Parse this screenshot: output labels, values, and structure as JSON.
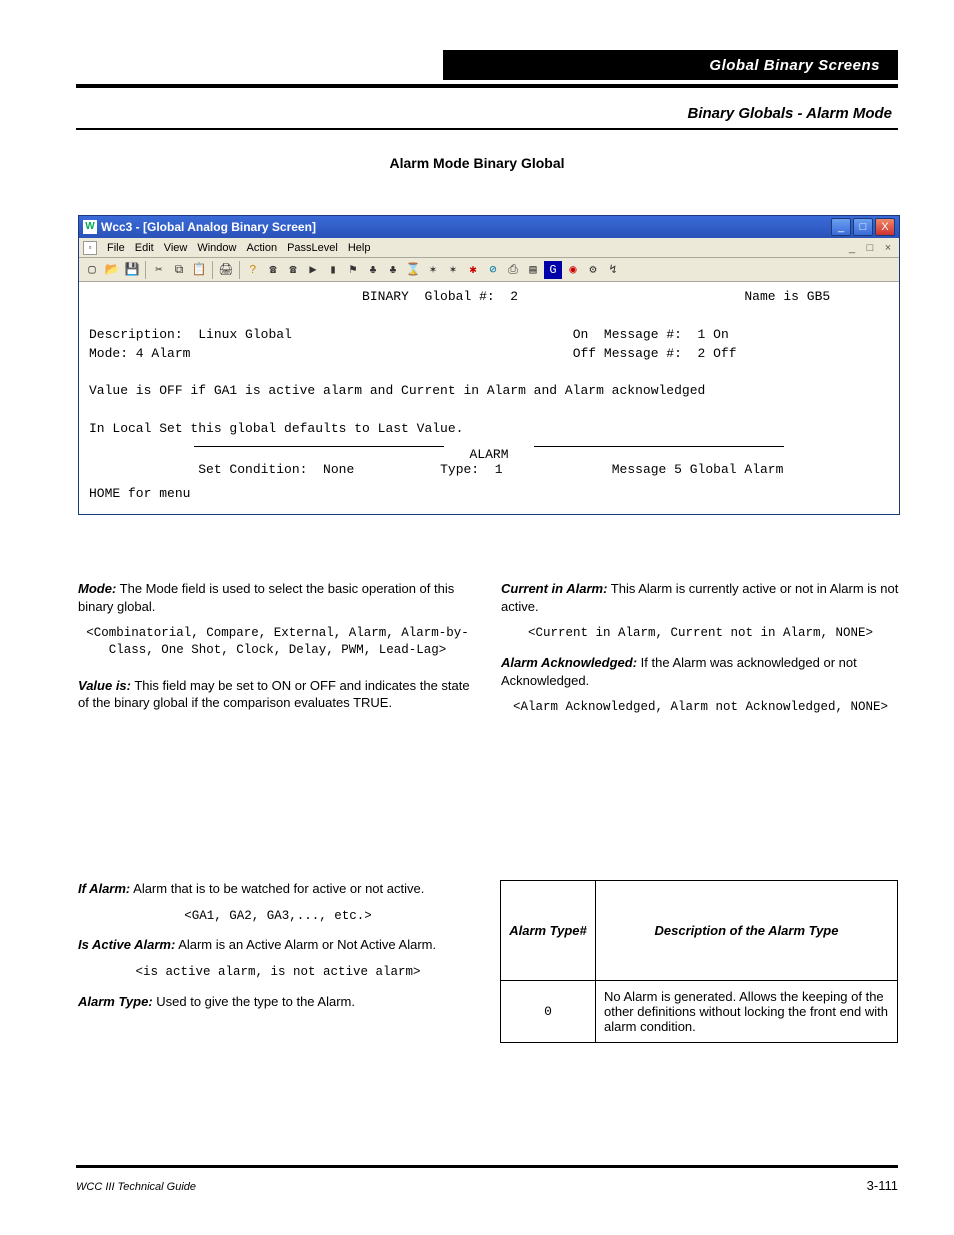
{
  "banner_title": "Global Binary Screens",
  "section_title": "Binary Globals - Alarm Mode",
  "subheader": "Alarm Mode Binary Global",
  "window": {
    "title": "Wcc3 - [Global Analog Binary Screen]",
    "menus": [
      "File",
      "Edit",
      "View",
      "Window",
      "Action",
      "PassLevel",
      "Help"
    ]
  },
  "terminal": {
    "line1_label_left": "BINARY  Global #:",
    "line1_value": "2",
    "line1_name_label": "Name is",
    "line1_name": "GB5",
    "desc_label": "Description:",
    "desc_value": "Linux Global",
    "onmsg_label": "On  Message #:",
    "onmsg_value": "1 On",
    "mode_label": "Mode: 4 Alarm",
    "offmsg_label": "Off Message #:",
    "offmsg_value": "2 Off",
    "value_line": "Value is OFF if GA1 is active alarm and Current in Alarm and Alarm acknowledged",
    "localset_line": "In Local Set this global defaults to Last Value.",
    "alarm_title": "ALARM",
    "setcond_label": "Set Condition:",
    "setcond_value": "None",
    "type_label": "Type:",
    "type_value": "1",
    "msg_prefix": "Message 5",
    "msg_text": "Global Alarm",
    "home_line": "HOME for menu"
  },
  "body": {
    "para1_prefix": "Mode:",
    "para1_text": " The Mode field is used to select the basic operation of this binary global.",
    "para1_options": "<Combinatorial, Compare, External, Alarm, Alarm-by-Class, One Shot, Clock, Delay, PWM, Lead-Lag>",
    "para2_prefix": "Current in Alarm:",
    "para2_text": " This Alarm is currently active or not in Alarm is not active.",
    "para2_options": "<Current in Alarm, Current not in Alarm, NONE>",
    "para3_prefix": "Alarm Acknowledged:",
    "para3_text": " If the Alarm was acknowledged or not Acknowledged.",
    "para3_options": "<Alarm Acknowledged, Alarm not Acknowledged, NONE>",
    "para4_prefix": "Value is:",
    "para4_text": " This field may be set to ON or OFF and indicates the state of the binary global if the comparison evaluates TRUE.",
    "left_block": [
      {
        "label": "If Alarm:",
        "text": " Alarm that is to be watched for active or not active.",
        "mono": "<GA1, GA2, GA3,..., etc.>"
      },
      {
        "label": "Is Active Alarm:",
        "text": " Alarm is an Active Alarm or Not Active Alarm.",
        "mono": "<is active alarm, is not active alarm>"
      },
      {
        "label": "Alarm Type:",
        "text": " Used to give the type to the Alarm."
      }
    ],
    "table": {
      "header_left": "Alarm Type#",
      "header_right": "Description of the Alarm Type",
      "rows": [
        {
          "num": "0",
          "desc": "No Alarm is generated. Allows the keeping of the other definitions without locking the front end with alarm condition."
        }
      ]
    }
  },
  "footer": {
    "left": "WCC III Technical Guide",
    "right": "3-111"
  }
}
